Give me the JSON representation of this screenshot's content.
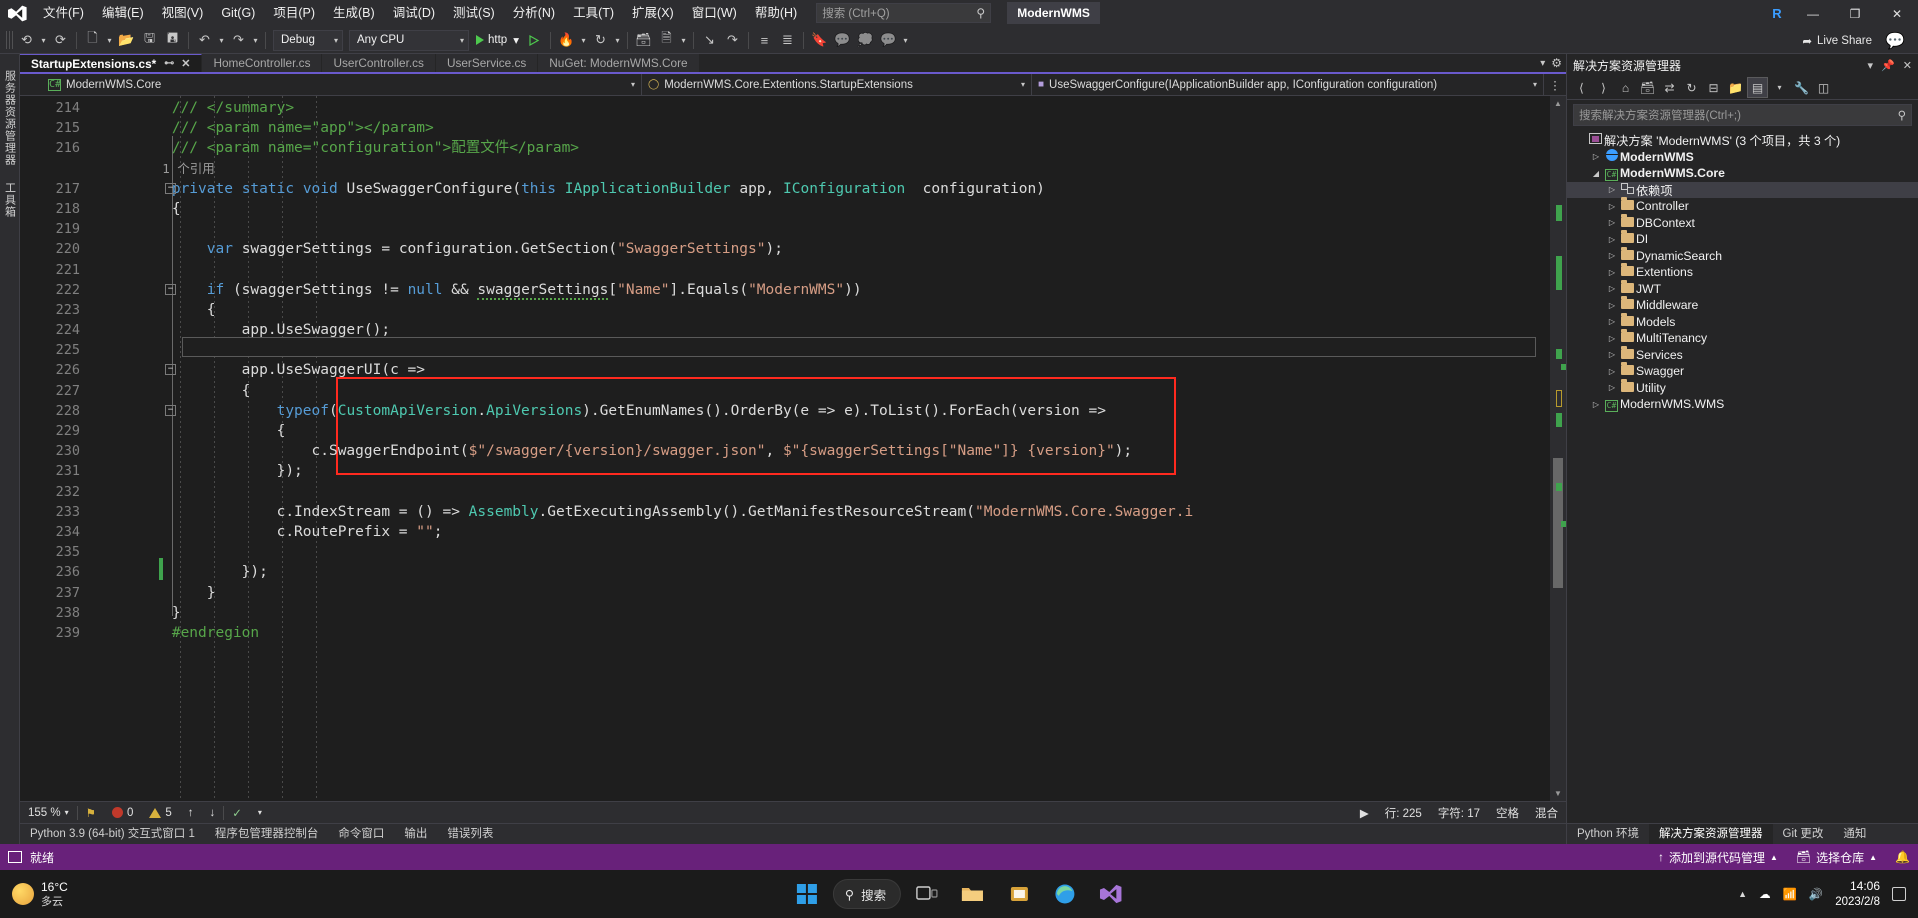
{
  "app": {
    "title": "ModernWMS",
    "account_initial": "R"
  },
  "menu": {
    "items": [
      "文件(F)",
      "编辑(E)",
      "视图(V)",
      "Git(G)",
      "项目(P)",
      "生成(B)",
      "调试(D)",
      "测试(S)",
      "分析(N)",
      "工具(T)",
      "扩展(X)",
      "窗口(W)",
      "帮助(H)"
    ],
    "search_placeholder": "搜索 (Ctrl+Q)"
  },
  "window_controls": {
    "minimize": "—",
    "restore": "❐",
    "close": "✕"
  },
  "toolbar": {
    "config": "Debug",
    "platform": "Any CPU",
    "run_target": "http",
    "live_share": "Live Share"
  },
  "tabs": [
    {
      "label": "StartupExtensions.cs*",
      "active": true,
      "pin": "⊷",
      "close": "✕"
    },
    {
      "label": "HomeController.cs",
      "active": false
    },
    {
      "label": "UserController.cs",
      "active": false
    },
    {
      "label": "UserService.cs",
      "active": false
    },
    {
      "label": "NuGet: ModernWMS.Core",
      "active": false
    }
  ],
  "navbar": {
    "project": "ModernWMS.Core",
    "type": "ModernWMS.Core.Extentions.StartupExtensions",
    "member": "UseSwaggerConfigure(IApplicationBuilder app, IConfiguration configuration)"
  },
  "left_dock": {
    "tabs": [
      "服务器资源管理器",
      "工具箱"
    ]
  },
  "code": {
    "lines": [
      {
        "num": "214",
        "indent": 0
      },
      {
        "num": "215",
        "indent": 0
      },
      {
        "num": "216",
        "indent": 0
      },
      {
        "num": "",
        "indent": 0,
        "reference": "1 个引用"
      },
      {
        "num": "217",
        "indent": 0
      },
      {
        "num": "218",
        "indent": 0
      },
      {
        "num": "219",
        "indent": 0
      },
      {
        "num": "220",
        "indent": 0
      },
      {
        "num": "221",
        "indent": 0
      },
      {
        "num": "222",
        "indent": 0
      },
      {
        "num": "223",
        "indent": 0
      },
      {
        "num": "224",
        "indent": 0
      },
      {
        "num": "225",
        "indent": 0
      },
      {
        "num": "226",
        "indent": 0
      },
      {
        "num": "227",
        "indent": 0
      },
      {
        "num": "228",
        "indent": 0
      },
      {
        "num": "229",
        "indent": 0
      },
      {
        "num": "230",
        "indent": 0
      },
      {
        "num": "231",
        "indent": 0
      },
      {
        "num": "232",
        "indent": 0
      },
      {
        "num": "233",
        "indent": 0
      },
      {
        "num": "234",
        "indent": 0
      },
      {
        "num": "235",
        "indent": 0
      },
      {
        "num": "236",
        "indent": 0
      },
      {
        "num": "237",
        "indent": 0
      },
      {
        "num": "238",
        "indent": 0
      },
      {
        "num": "239",
        "indent": 0
      }
    ],
    "reference_label": "1 个引用"
  },
  "editor_status": {
    "zoom": "155 %",
    "errors": "0",
    "warnings": "5",
    "line_label": "行: 225",
    "col_label": "字符: 17",
    "spaces_label": "空格",
    "mixed_label": "混合"
  },
  "bottom_tabs": [
    {
      "label": "Python 3.9 (64-bit) 交互式窗口 1",
      "active": false
    },
    {
      "label": "程序包管理器控制台",
      "active": false
    },
    {
      "label": "命令窗口",
      "active": false
    },
    {
      "label": "输出",
      "active": false
    },
    {
      "label": "错误列表",
      "active": false
    }
  ],
  "solution_explorer": {
    "title": "解决方案资源管理器",
    "search_placeholder": "搜索解决方案资源管理器(Ctrl+;)",
    "tree": [
      {
        "level": 0,
        "arrow": "",
        "icon": "sln",
        "label": "解决方案 'ModernWMS' (3 个项目，共 3 个)",
        "bold": false
      },
      {
        "level": 1,
        "arrow": "▷",
        "icon": "web",
        "label": "ModernWMS",
        "bold": true
      },
      {
        "level": 1,
        "arrow": "◢",
        "icon": "cs",
        "label": "ModernWMS.Core",
        "bold": true
      },
      {
        "level": 2,
        "arrow": "▷",
        "icon": "dep",
        "label": "依赖项",
        "bold": false,
        "selected": true
      },
      {
        "level": 2,
        "arrow": "▷",
        "icon": "folder",
        "label": "Controller",
        "bold": false
      },
      {
        "level": 2,
        "arrow": "▷",
        "icon": "folder",
        "label": "DBContext",
        "bold": false
      },
      {
        "level": 2,
        "arrow": "▷",
        "icon": "folder",
        "label": "DI",
        "bold": false
      },
      {
        "level": 2,
        "arrow": "▷",
        "icon": "folder",
        "label": "DynamicSearch",
        "bold": false
      },
      {
        "level": 2,
        "arrow": "▷",
        "icon": "folder",
        "label": "Extentions",
        "bold": false
      },
      {
        "level": 2,
        "arrow": "▷",
        "icon": "folder",
        "label": "JWT",
        "bold": false
      },
      {
        "level": 2,
        "arrow": "▷",
        "icon": "folder",
        "label": "Middleware",
        "bold": false
      },
      {
        "level": 2,
        "arrow": "▷",
        "icon": "folder",
        "label": "Models",
        "bold": false
      },
      {
        "level": 2,
        "arrow": "▷",
        "icon": "folder",
        "label": "MultiTenancy",
        "bold": false
      },
      {
        "level": 2,
        "arrow": "▷",
        "icon": "folder",
        "label": "Services",
        "bold": false
      },
      {
        "level": 2,
        "arrow": "▷",
        "icon": "folder",
        "label": "Swagger",
        "bold": false
      },
      {
        "level": 2,
        "arrow": "▷",
        "icon": "folder",
        "label": "Utility",
        "bold": false
      },
      {
        "level": 1,
        "arrow": "▷",
        "icon": "cs",
        "label": "ModernWMS.WMS",
        "bold": false
      }
    ],
    "bottom_tabs": [
      {
        "label": "Python 环境",
        "active": false
      },
      {
        "label": "解决方案资源管理器",
        "active": true
      },
      {
        "label": "Git 更改",
        "active": false
      },
      {
        "label": "通知",
        "active": false
      }
    ]
  },
  "status_bar": {
    "ready": "就绪",
    "add_to_source_control": "添加到源代码管理",
    "select_repo": "选择仓库"
  },
  "taskbar": {
    "temperature": "16°C",
    "condition": "多云",
    "search": "搜索",
    "time": "14:06",
    "date": "2023/2/8"
  }
}
